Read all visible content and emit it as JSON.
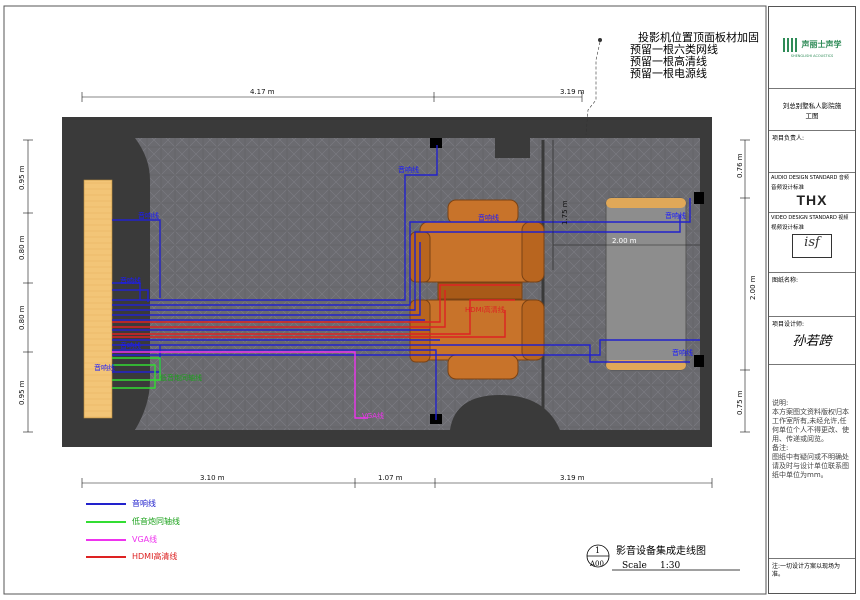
{
  "notes": {
    "line1": "投影机位置顶面板材加固",
    "line2": "预留一根六类网线",
    "line3": "预留一根高清线",
    "line4": "预留一根电源线"
  },
  "dimensions": {
    "top_left": "4.17 m",
    "top_right": "3.19 m",
    "bottom_left": "3.10 m",
    "bottom_mid": "1.07 m",
    "bottom_right": "3.19 m",
    "left_1": "0.95 m",
    "left_2": "0.80 m",
    "left_3": "0.80 m",
    "left_4": "0.95 m",
    "right_top": "0.76 m",
    "right_mid": "2.00 m",
    "right_bottom": "0.75 m",
    "inner_vertical": "1.75 m",
    "inner_horizontal": "2.00 m"
  },
  "wire_labels": {
    "speaker_a": "音响线",
    "speaker_b": "音响线",
    "speaker_c": "音响线",
    "speaker_d": "音响线",
    "speaker_e": "音响线",
    "speaker_f": "音响线",
    "speaker_g": "音响线",
    "speaker_h": "音响线",
    "subwoofer": "低音炮同轴线",
    "hdmi": "HDMI高清线",
    "vga": "VGA线"
  },
  "legend": [
    {
      "label": "音响线",
      "color": "#2222cc"
    },
    {
      "label": "低音炮同轴线",
      "color": "#33dd33"
    },
    {
      "label": "VGA线",
      "color": "#ee33ee"
    },
    {
      "label": "HDMI高清线",
      "color": "#dd2222"
    }
  ],
  "drawing_title": {
    "number": "1",
    "sheet": "A00",
    "title": "影音设备集成走线图",
    "scale_label": "Scale",
    "scale_value": "1:30"
  },
  "title_block": {
    "company": "声丽士声学",
    "company_sub": "SHENGLISHI ACOUSTICS",
    "project": "刘总别墅私人影院施工图",
    "manager_label": "项目负责人:",
    "audio_std_label": "AUDIO DESIGN STANDARD 音频",
    "audio_std": "音频设计标准",
    "audio_logo": "THX",
    "video_std_label": "VIDEO DESIGN STANDARD 视频",
    "video_std": "视频设计标准",
    "video_logo": "isf",
    "drawing_name_label": "图纸名称:",
    "designer_label": "项目设计师:",
    "signature": "孙若跨",
    "remarks": "说明:\n本方案图文资料版权归本工作室所有,未经允许,任何单位个人不得更改、使用、传递或阅览。\n备注:\n图纸中有疑问或不明确处请及时与设计单位联系图纸中单位为mm。",
    "footer": "注:一切设计方案以现场为准。"
  },
  "colors": {
    "speaker": "#2222cc",
    "subwoofer": "#33dd33",
    "vga": "#ee33ee",
    "hdmi": "#dd2222",
    "wall": "#3c3c3c",
    "carpet": "#6e6e72",
    "seat": "#c8732a",
    "screen_panel": "#f5c16b",
    "sofa": "#8a8a8a",
    "brand": "#2e8b57"
  }
}
